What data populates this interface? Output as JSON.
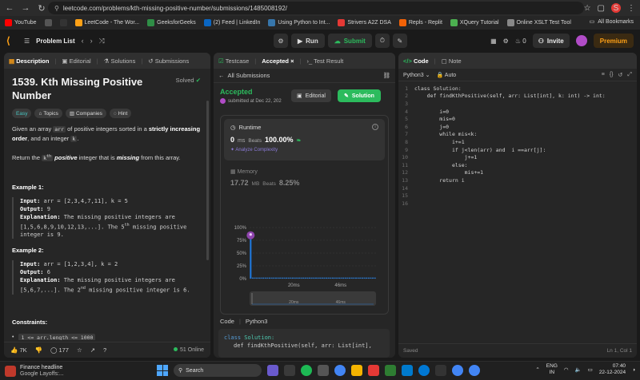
{
  "browser": {
    "url": "leetcode.com/problems/kth-missing-positive-number/submissions/1485008192/",
    "profile_initial": "S",
    "bookmarks": [
      {
        "label": "YouTube",
        "color": "#ff0000"
      },
      {
        "label": "",
        "color": "#555555"
      },
      {
        "label": "",
        "color": "#333333"
      },
      {
        "label": "LeetCode - The Wor...",
        "color": "#ffa116"
      },
      {
        "label": "GeeksforGeeks",
        "color": "#2f8d46"
      },
      {
        "label": "(2) Feed | LinkedIn",
        "color": "#0a66c2"
      },
      {
        "label": "Using Python to Int...",
        "color": "#3776ab"
      },
      {
        "label": "Strivers A2Z DSA",
        "color": "#e53935"
      },
      {
        "label": "Repls - Replit",
        "color": "#f26207"
      },
      {
        "label": "XQuery Tutorial",
        "color": "#4caf50"
      },
      {
        "label": "Online XSLT Test Tool",
        "color": "#888888"
      }
    ],
    "all_bookmarks": "All Bookmarks"
  },
  "header": {
    "problem_list": "Problem List",
    "run": "Run",
    "submit": "Submit",
    "streak": "0",
    "invite": "Invite",
    "premium": "Premium"
  },
  "description": {
    "tabs": [
      "Description",
      "Editorial",
      "Solutions",
      "Submissions"
    ],
    "title": "1539. Kth Missing Positive Number",
    "solved": "Solved",
    "tags": [
      "Easy",
      "Topics",
      "Companies",
      "Hint"
    ],
    "statement_1a": "Given an array ",
    "statement_1code": "arr",
    "statement_1b": " of positive integers sorted in a ",
    "statement_1strong": "strictly increasing order",
    "statement_1c": ", and an integer ",
    "statement_1k": "k",
    "statement_1d": ".",
    "statement_2a": "Return the ",
    "statement_2sup": "th",
    "statement_2b": "positive",
    "statement_2c": " integer that is ",
    "statement_2d": "missing",
    "statement_2e": " from this array.",
    "example1_title": "Example 1:",
    "example1": {
      "input": "arr = [2,3,4,7,11], k = 5",
      "output": "9",
      "explanation_a": "The missing positive integers are [1,5,6,8,9,10,12,13,...]. The 5",
      "explanation_sup": "th",
      "explanation_b": " missing positive integer is 9."
    },
    "example2_title": "Example 2:",
    "example2": {
      "input": "arr = [1,2,3,4], k = 2",
      "output": "6",
      "explanation_a": "The missing positive integers are [5,6,7,...]. The 2",
      "explanation_sup": "nd",
      "explanation_b": " missing positive integer is 6."
    },
    "constraints_title": "Constraints:",
    "constraint_1": "1 <= arr.length <= 1000",
    "labels": {
      "input": "Input:",
      "output": "Output:",
      "explanation": "Explanation:"
    },
    "footer": {
      "likes": "7K",
      "comments": "177",
      "online": "51 Online"
    }
  },
  "submission": {
    "tabs": [
      "Testcase",
      "Accepted",
      "Test Result"
    ],
    "all_submissions": "All Submissions",
    "status": "Accepted",
    "submitted_at": "submitted at Dec 22, 202",
    "editorial_btn": "Editorial",
    "solution_btn": "Solution",
    "runtime_label": "Runtime",
    "runtime_value": "0",
    "runtime_unit": "ms",
    "runtime_beats_label": "Beats",
    "runtime_beats": "100.00%",
    "analyze": "Analyze Complexity",
    "memory_label": "Memory",
    "memory_value": "17.72",
    "memory_unit": "MB",
    "memory_beats_label": "Beats",
    "memory_beats": "8.25%",
    "code_label": "Code",
    "code_lang": "Python3",
    "code_line1_kw": "class",
    "code_line1_name": "Solution:",
    "code_line2": "def findKthPositive(self, arr: List[int],"
  },
  "chart_data": {
    "type": "bar",
    "yticks": [
      "100%",
      "75%",
      "50%",
      "25%",
      "0%"
    ],
    "xticks": [
      "20ms",
      "46ms"
    ],
    "brush_ticks": [
      "20ms",
      "46ms"
    ],
    "ylim": [
      0,
      100
    ],
    "highlight_value": 77,
    "values": [
      77,
      2,
      2,
      2,
      2,
      2,
      2,
      2,
      2,
      2,
      2,
      2,
      2,
      2,
      2,
      2,
      2,
      2,
      2,
      2,
      2,
      2,
      2,
      2,
      2,
      2,
      2,
      2,
      2,
      2,
      2,
      2,
      2,
      2,
      2,
      2,
      2,
      2,
      2,
      2,
      2,
      2,
      2,
      2,
      2,
      2,
      2,
      2,
      2,
      2,
      2,
      2,
      2,
      2,
      2,
      2,
      2,
      2,
      2,
      2
    ]
  },
  "code_panel": {
    "tabs": [
      "Code",
      "Note"
    ],
    "language": "Python3",
    "auto": "Auto",
    "status": "Saved",
    "cursor": "Ln 1, Col 1",
    "lines": [
      "class Solution:",
      "    def findKthPositive(self, arr: List[int], k: int) -> int:",
      "",
      "        i=0",
      "        mis=0",
      "        j=0",
      "        while mis<k:",
      "            i+=1",
      "            if j<len(arr) and  i ==arr[j]:",
      "                j+=1",
      "            else:",
      "                mis+=1",
      "        return i",
      "",
      "",
      ""
    ]
  },
  "taskbar": {
    "news_title": "Finance headline",
    "news_sub": "Google Layoffs:...",
    "search": "Search",
    "lang": "ENG",
    "region": "IN",
    "time": "07:40",
    "date": "22-12-2024"
  }
}
